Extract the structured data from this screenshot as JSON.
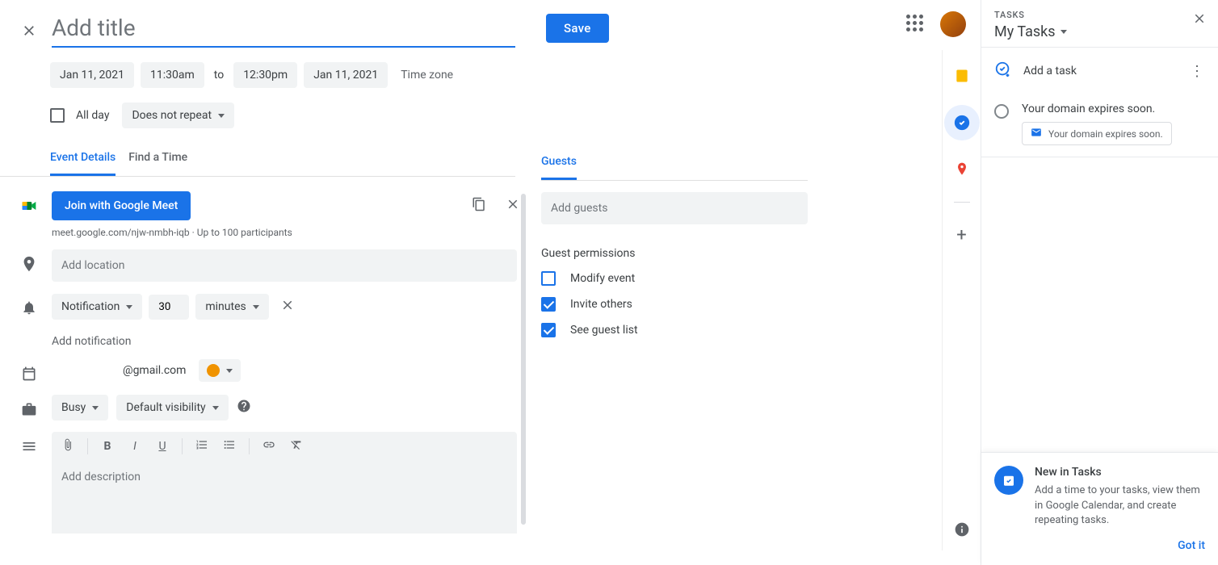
{
  "header": {
    "title_placeholder": "Add title",
    "save": "Save"
  },
  "dates": {
    "start_date": "Jan 11, 2021",
    "start_time": "11:30am",
    "to": "to",
    "end_time": "12:30pm",
    "end_date": "Jan 11, 2021",
    "timezone": "Time zone"
  },
  "allday": {
    "label": "All day",
    "repeat": "Does not repeat"
  },
  "tabs": {
    "event_details": "Event Details",
    "find_time": "Find a Time"
  },
  "meet": {
    "join": "Join with Google Meet",
    "link": "meet.google.com/njw-nmbh-iqb · Up to 100 participants"
  },
  "location": {
    "placeholder": "Add location"
  },
  "notification": {
    "type": "Notification",
    "value": "30",
    "unit": "minutes",
    "add": "Add notification"
  },
  "calendar": {
    "email": "@gmail.com"
  },
  "visibility": {
    "busy": "Busy",
    "default": "Default visibility"
  },
  "description": {
    "placeholder": "Add description"
  },
  "guests": {
    "tab": "Guests",
    "placeholder": "Add guests",
    "permissions_title": "Guest permissions",
    "modify": "Modify event",
    "invite": "Invite others",
    "see_list": "See guest list"
  },
  "tasks": {
    "label": "TASKS",
    "list_name": "My Tasks",
    "add": "Add a task",
    "item_title": "Your domain expires soon.",
    "item_chip": "Your domain expires soon.",
    "popup_title": "New in Tasks",
    "popup_text": "Add a time to your tasks, view them in Google Calendar, and create repeating tasks.",
    "gotit": "Got it"
  }
}
